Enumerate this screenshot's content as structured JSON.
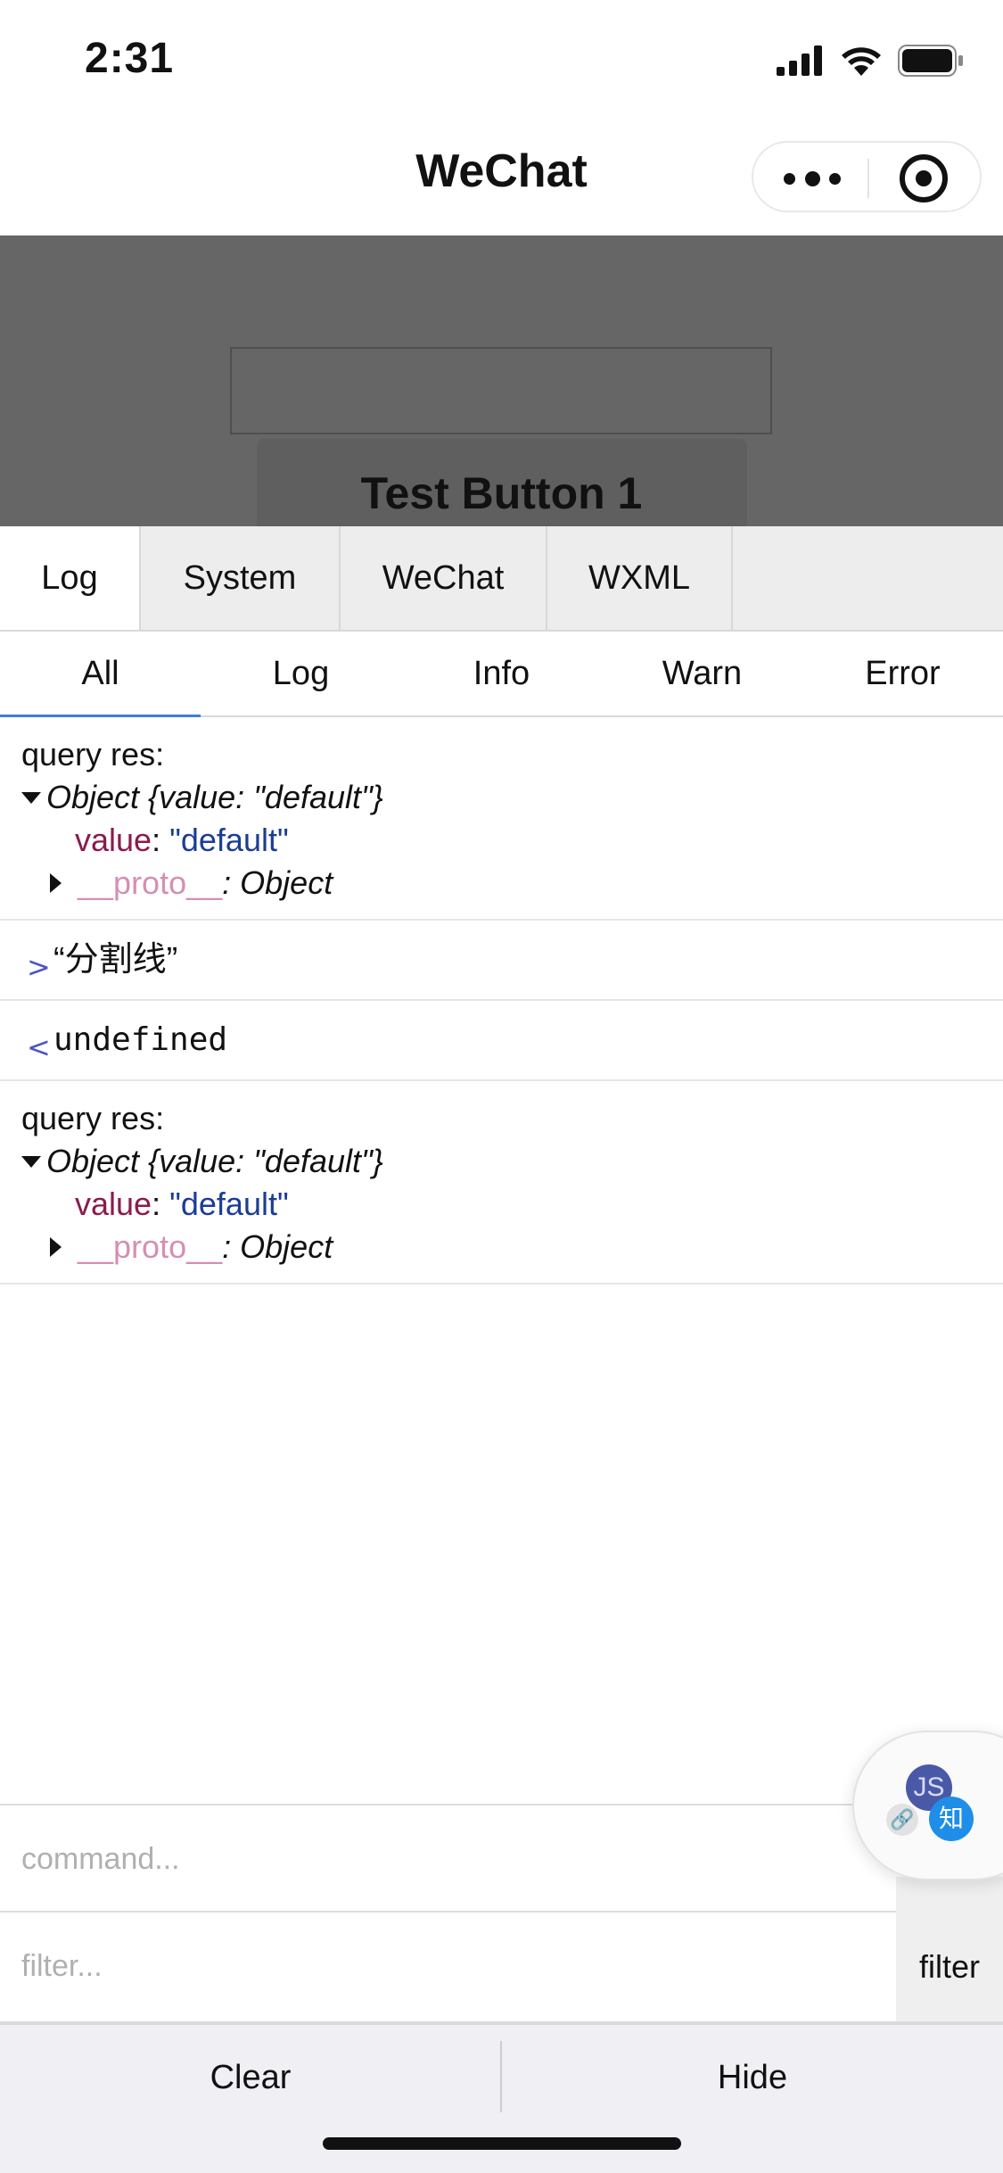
{
  "status_bar": {
    "time": "2:31",
    "icons": [
      "cellular-signal-icon",
      "wifi-icon",
      "battery-icon"
    ]
  },
  "nav_bar": {
    "title": "WeChat",
    "more_icon": "more-dots-icon",
    "close_icon": "target-close-icon"
  },
  "page": {
    "button_label": "Test Button 1"
  },
  "vconsole": {
    "tabs": [
      {
        "label": "Log",
        "active": true
      },
      {
        "label": "System",
        "active": false
      },
      {
        "label": "WeChat",
        "active": false
      },
      {
        "label": "WXML",
        "active": false
      }
    ],
    "sub_tabs": [
      {
        "label": "All",
        "active": true
      },
      {
        "label": "Log",
        "active": false
      },
      {
        "label": "Info",
        "active": false
      },
      {
        "label": "Warn",
        "active": false
      },
      {
        "label": "Error",
        "active": false
      }
    ],
    "logs": [
      {
        "head": "query res:",
        "object_label": "Object {value: \"default\"}",
        "key": "value",
        "colon": ":",
        "value": "\"default\"",
        "proto_key": "__proto__",
        "proto_value": ": Object"
      },
      {
        "arrow": ">",
        "text": "“分割线”"
      },
      {
        "arrow": "<",
        "text": "undefined"
      },
      {
        "head": "query res:",
        "object_label": "Object {value: \"default\"}",
        "key": "value",
        "colon": ":",
        "value": "\"default\"",
        "proto_key": "__proto__",
        "proto_value": ": Object"
      }
    ],
    "float_badge": {
      "js": "JS",
      "zhi": "知"
    },
    "command_placeholder": "command...",
    "filter_placeholder": "filter...",
    "filter_button": "filter",
    "clear_button": "Clear",
    "hide_button": "Hide"
  },
  "colors": {
    "overlay": "#666666",
    "active_tab_underline": "#3e7fd8",
    "key_color": "#8a1b4e",
    "string_color": "#1c3d94",
    "proto_color": "#d58fb3"
  }
}
